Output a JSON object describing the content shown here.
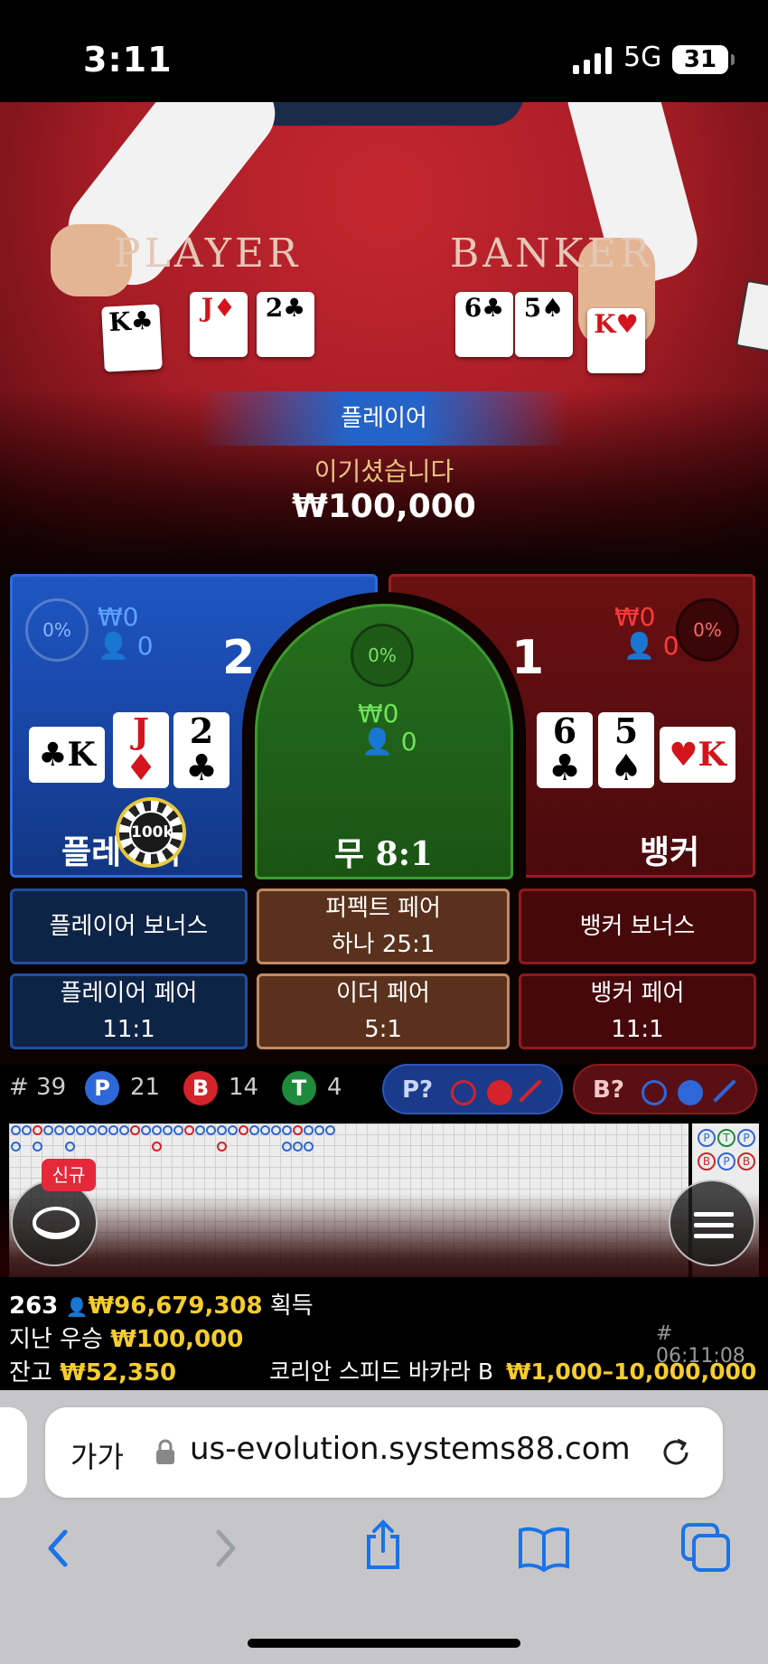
{
  "status_bar": {
    "time": "3:11",
    "network": "5G",
    "battery": "31"
  },
  "table": {
    "player_label": "PLAYER",
    "banker_label": "BANKER",
    "player_cards": [
      {
        "rank": "K",
        "suit": "♣",
        "red": false
      },
      {
        "rank": "J",
        "suit": "♦",
        "red": true
      },
      {
        "rank": "2",
        "suit": "♣",
        "red": false
      }
    ],
    "banker_cards": [
      {
        "rank": "6",
        "suit": "♣",
        "red": false
      },
      {
        "rank": "5",
        "suit": "♠",
        "red": false
      },
      {
        "rank": "K",
        "suit": "♥",
        "red": true
      }
    ]
  },
  "result": {
    "winner": "플레이어",
    "message": "이기셨습니다",
    "amount": "₩100,000"
  },
  "bets": {
    "player": {
      "pct": "0%",
      "amount": "₩0",
      "players": "0",
      "score": "2",
      "label": "플레이어",
      "cards": [
        {
          "rank": "K",
          "suit": "♣",
          "red": false
        },
        {
          "rank": "J",
          "suit": "♦",
          "red": true
        },
        {
          "rank": "2",
          "suit": "♣",
          "red": false
        }
      ],
      "chip": "100k"
    },
    "tie": {
      "pct": "0%",
      "amount": "₩0",
      "players": "0",
      "label": "무",
      "payout": "8:1"
    },
    "banker": {
      "pct": "0%",
      "amount": "₩0",
      "players": "0",
      "score": "1",
      "label": "뱅커",
      "cards": [
        {
          "rank": "6",
          "suit": "♣",
          "red": false
        },
        {
          "rank": "5",
          "suit": "♠",
          "red": false
        },
        {
          "rank": "K",
          "suit": "♥",
          "red": true
        }
      ]
    }
  },
  "side_bets": {
    "player_bonus": "플레이어 보너스",
    "perfect_pair": {
      "line1": "퍼펙트 페어",
      "line2": "하나 25:1"
    },
    "banker_bonus": "뱅커 보너스",
    "player_pair": {
      "line1": "플레이어 페어",
      "line2": "11:1"
    },
    "either_pair": {
      "line1": "이더 페어",
      "line2": "5:1"
    },
    "banker_pair": {
      "line1": "뱅커 페어",
      "line2": "11:1"
    }
  },
  "stats": {
    "round": "# 39",
    "p_label": "P",
    "p_count": "21",
    "b_label": "B",
    "b_count": "14",
    "t_label": "T",
    "t_count": "4",
    "p_ask": "P?",
    "b_ask": "B?"
  },
  "roadmap": {
    "new_badge": "신규",
    "side_labels": [
      "P",
      "T",
      "P",
      "B",
      "P",
      "B"
    ]
  },
  "info": {
    "players": "263",
    "total_won": "₩96,679,308",
    "won_label": "획득",
    "last_win_label": "지난 우승",
    "last_win": "₩100,000",
    "round_id": "# 06:11:08",
    "balance_label": "잔고",
    "balance": "₩52,350",
    "table_name": "코리안 스피드 바카라 B",
    "limits": "₩1,000–10,000,000"
  },
  "browser": {
    "text_size": "가가",
    "url": "us-evolution.systems88.com"
  },
  "colors": {
    "gold": "#f5cd2e",
    "player_blue": "#1e56c2",
    "banker_red": "#8f1a1f",
    "tie_green": "#266e1e",
    "ios_blue": "#1a73e8"
  }
}
